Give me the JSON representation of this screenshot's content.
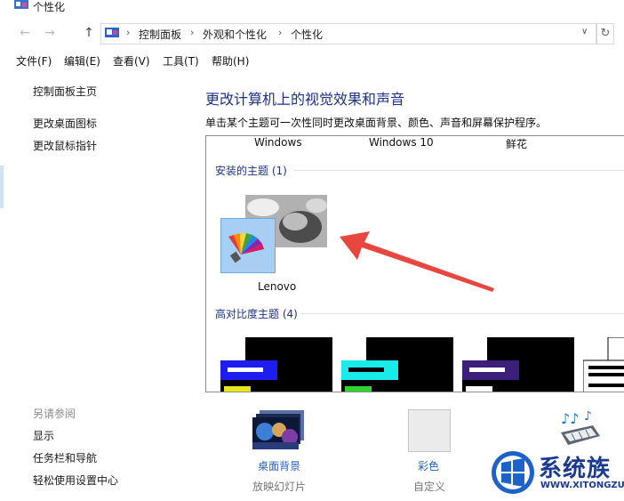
{
  "window": {
    "title": "个性化"
  },
  "address": {
    "crumbs": [
      "控制面板",
      "外观和个性化",
      "个性化"
    ]
  },
  "menu": [
    "文件(F)",
    "编辑(E)",
    "查看(V)",
    "工具(T)",
    "帮助(H)"
  ],
  "left": {
    "links": [
      "控制面板主页",
      "更改桌面图标",
      "更改鼠标指针"
    ],
    "see_also": "另请参阅",
    "see_links": [
      "显示",
      "任务栏和导航",
      "轻松使用设置中心"
    ]
  },
  "main": {
    "heading": "更改计算机上的视觉效果和声音",
    "description": "单击某个主题可一次性同时更改桌面背景、颜色、声音和屏幕保护程序。",
    "top_theme_names": [
      "Windows",
      "Windows 10",
      "鲜花"
    ],
    "installed_title": "安装的主题 (1)",
    "lenovo_label": "Lenovo",
    "high_contrast_title": "高对比度主题 (4)"
  },
  "bottom": {
    "background_label": "桌面背景",
    "background_sub": "放映幻灯片",
    "color_label": "彩色",
    "color_sub": "自定义"
  },
  "watermark": {
    "text": "系统族",
    "url": "WWW.XITONGZU.COM"
  },
  "colors": {
    "heading": "#1e3287",
    "link": "#2a62b8",
    "arrow": "#e8473f"
  }
}
